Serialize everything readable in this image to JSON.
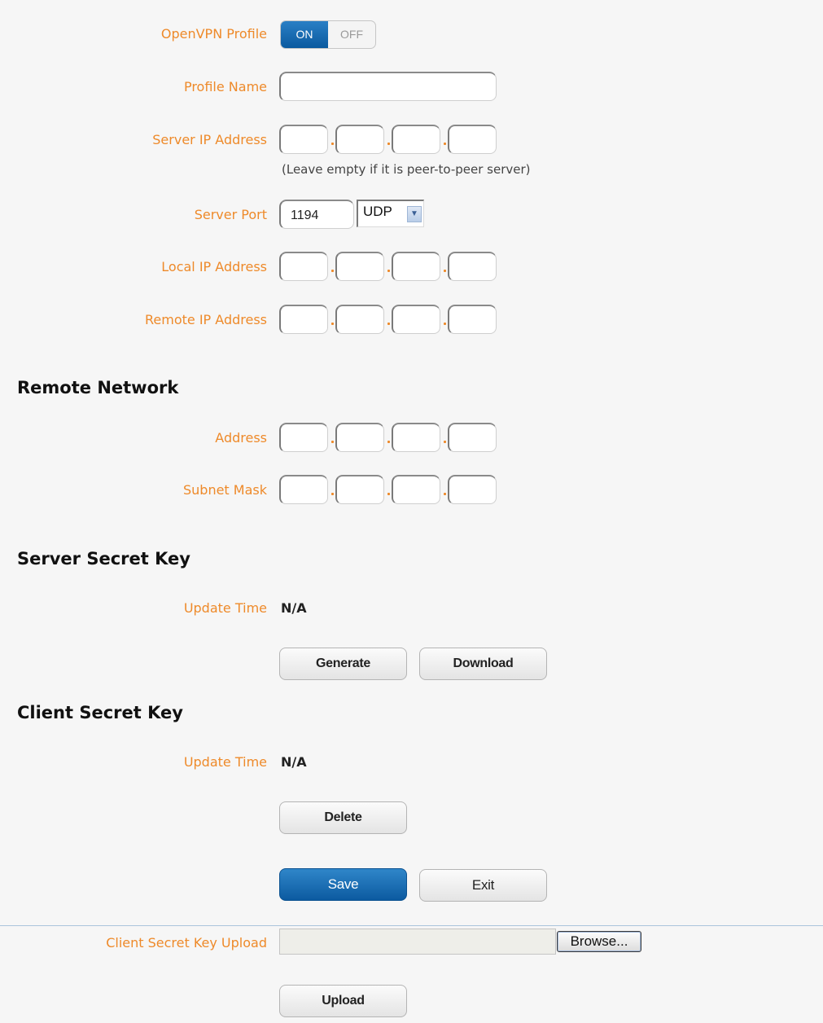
{
  "openvpn_profile": {
    "label": "OpenVPN Profile",
    "on": "ON",
    "off": "OFF"
  },
  "profile_name": {
    "label": "Profile Name",
    "value": ""
  },
  "server_ip": {
    "label": "Server IP Address",
    "note": "(Leave empty if it is peer-to-peer server)"
  },
  "server_port": {
    "label": "Server Port",
    "value": "1194",
    "protocol": "UDP"
  },
  "local_ip": {
    "label": "Local IP Address"
  },
  "remote_ip": {
    "label": "Remote IP Address"
  },
  "remote_network": {
    "title": "Remote Network",
    "address_label": "Address",
    "subnet_label": "Subnet Mask"
  },
  "server_secret_key": {
    "title": "Server Secret Key",
    "update_label": "Update Time",
    "update_value": "N/A",
    "generate": "Generate",
    "download": "Download"
  },
  "client_secret_key": {
    "title": "Client Secret Key",
    "update_label": "Update Time",
    "update_value": "N/A",
    "delete": "Delete"
  },
  "actions": {
    "save": "Save",
    "exit": "Exit"
  },
  "upload": {
    "label": "Client Secret Key Upload",
    "browse": "Browse...",
    "upload": "Upload"
  },
  "colors": {
    "label": "#ee8a2a",
    "primary": "#0c5aa0"
  }
}
